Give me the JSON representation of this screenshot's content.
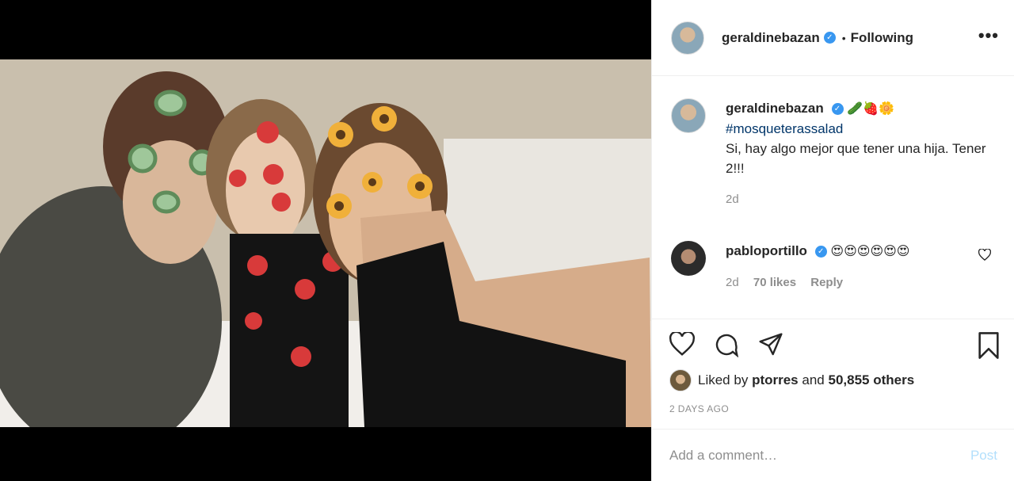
{
  "post": {
    "username": "geraldinebazan",
    "verified_glyph": "✓",
    "dot": "•",
    "follow_status": "Following",
    "more_glyph": "•••"
  },
  "caption": {
    "username": "geraldinebazan",
    "emojis": "🥒🍓🌼",
    "hashtag": "#mosqueterassalad",
    "text": "Si, hay algo mejor que tener una hija. Tener 2!!!",
    "time": "2d"
  },
  "comment": {
    "username": "pabloportillo",
    "emojis": "😍😍😍😍😍😍",
    "time": "2d",
    "likes": "70 likes",
    "reply": "Reply"
  },
  "likes": {
    "prefix": "Liked by",
    "user": "ptorres",
    "middle": "and",
    "others": "50,855 others"
  },
  "timestamp": "2 DAYS AGO",
  "add_comment": {
    "placeholder": "Add a comment…",
    "post_label": "Post"
  },
  "colors": {
    "verified": "#3897f0",
    "hashtag": "#003569",
    "post_disabled": "#b2dffc",
    "muted": "#8e8e8e"
  },
  "icons": [
    "heart-icon",
    "comment-icon",
    "share-icon",
    "bookmark-icon",
    "more-icon"
  ]
}
